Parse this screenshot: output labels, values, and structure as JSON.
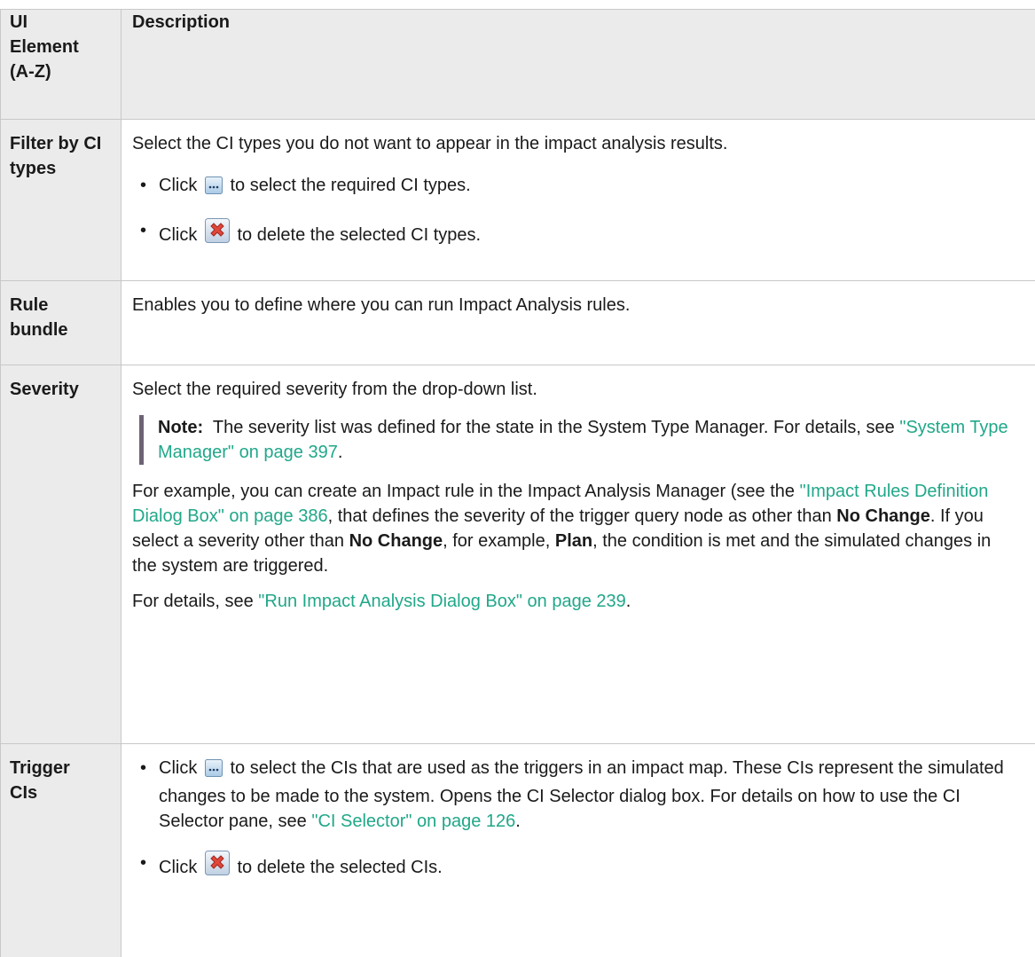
{
  "header": {
    "col1": "UI Element (A-Z)",
    "col2": "Description"
  },
  "rows": [
    {
      "element": "Filter by CI types",
      "intro": "Select the CI types you do not want to appear in the impact analysis results.",
      "bullets": [
        {
          "before": "Click",
          "icon": "ellipsis-button-icon",
          "after": "to select the required CI types."
        },
        {
          "before": "Click",
          "icon": "delete-x-icon",
          "after": "to delete the selected CI types."
        }
      ]
    },
    {
      "element": "Rule bundle",
      "text": "Enables you to define where you can run Impact Analysis rules."
    },
    {
      "element": "Severity",
      "intro": "Select the required severity from the drop-down list.",
      "note_label": "Note:",
      "note_text": "The severity list was defined for the state in the System Type Manager. For details, see",
      "note_link": "\"System Type Manager\" on page 397",
      "note_end": ".",
      "para1_a": "For example, you can create an Impact rule in the Impact Analysis Manager (see the",
      "para1_link": "\"Impact Rules Definition Dialog Box\" on page 386",
      "para1_b": ", that defines the severity of the trigger query node as other than",
      "para1_bold1": "No Change",
      "para1_c": ". If you select a severity other than",
      "para1_bold2": "No Change",
      "para1_d": ", for example,",
      "para1_bold3": "Plan",
      "para1_e": ", the condition is met and the simulated changes in the system are triggered.",
      "para2_a": "For details, see",
      "para2_link": "\"Run Impact Analysis Dialog Box\" on page 239",
      "para2_end": "."
    },
    {
      "element": "Trigger CIs",
      "bullet1_before": "Click",
      "bullet1_icon": "ellipsis-button-icon",
      "bullet1_after": "to select the CIs that are used as the triggers in an impact map. These CIs represent the simulated changes to be made to the system. Opens the CI Selector dialog box. For details on how to use the CI Selector pane, see",
      "bullet1_link": "\"CI Selector\" on page 126",
      "bullet1_end": ".",
      "bullet2_before": "Click",
      "bullet2_icon": "delete-x-icon",
      "bullet2_after": "to delete the selected CIs."
    }
  ],
  "colors": {
    "link": "#21a789",
    "header_bg": "#ebebeb",
    "note_bar": "#6e6275"
  }
}
